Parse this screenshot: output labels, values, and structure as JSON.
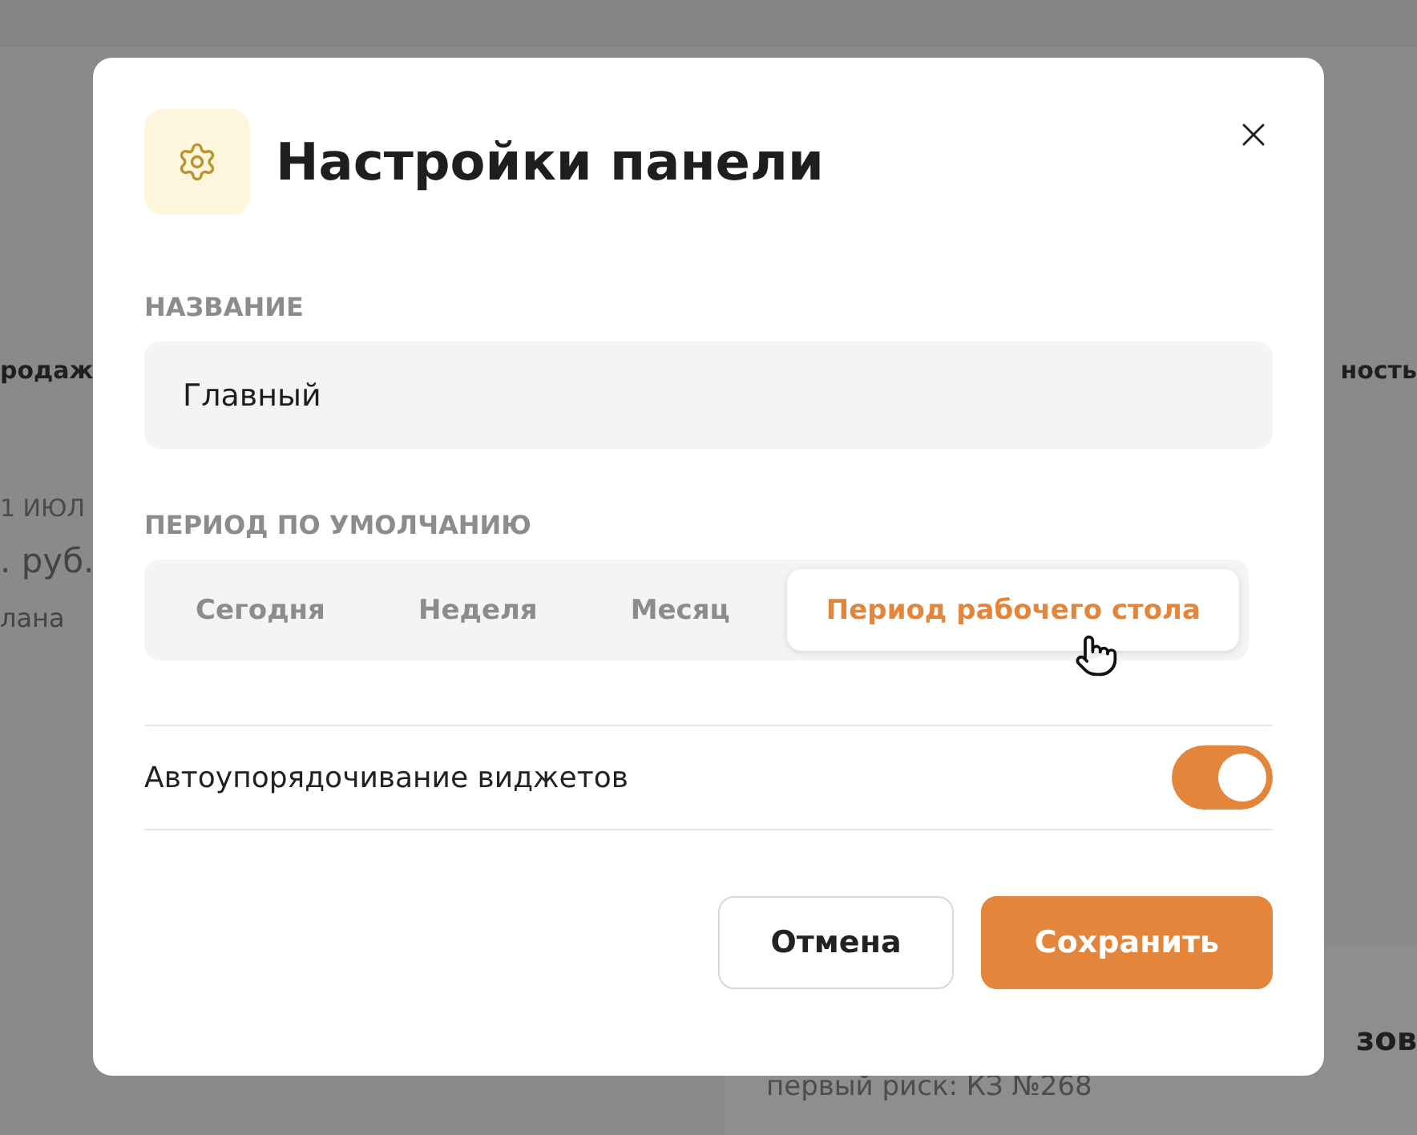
{
  "background": {
    "left": {
      "heading": "родаж",
      "date": "1 ИЮЛ",
      "amount": ". руб.",
      "caption": "лана"
    },
    "right": {
      "heading": "ность"
    },
    "card": {
      "title": "зов",
      "subtitle": "первый риск: КЗ №268"
    }
  },
  "dialog": {
    "title": "Настройки панели",
    "name_field": {
      "label": "НАЗВАНИЕ",
      "value": "Главный"
    },
    "period": {
      "label": "ПЕРИОД ПО УМОЛЧАНИЮ",
      "options": [
        {
          "label": "Сегодня",
          "selected": false
        },
        {
          "label": "Неделя",
          "selected": false
        },
        {
          "label": "Месяц",
          "selected": false
        },
        {
          "label": "Период рабочего стола",
          "selected": true
        }
      ]
    },
    "toggle": {
      "label": "Автоупорядочивание виджетов",
      "on": true
    },
    "buttons": [
      {
        "label": "Отмена",
        "kind": "secondary"
      },
      {
        "label": "Сохранить",
        "kind": "primary"
      }
    ]
  }
}
